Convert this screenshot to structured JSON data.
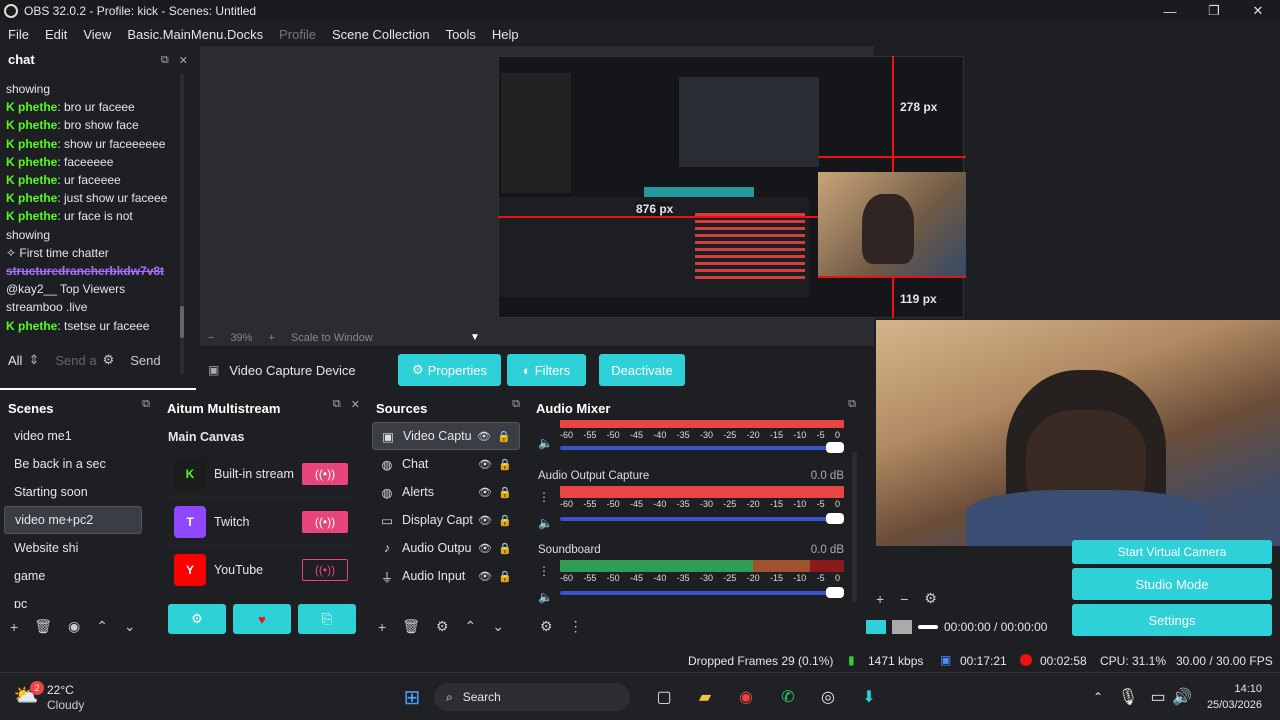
{
  "window": {
    "title": "OBS 32.0.2 - Profile: kick - Scenes: Untitled"
  },
  "menu": {
    "file": "File",
    "edit": "Edit",
    "view": "View",
    "docks": "Basic.MainMenu.Docks",
    "profile": "Profile",
    "scene_collection": "Scene Collection",
    "tools": "Tools",
    "help": "Help"
  },
  "chat": {
    "title": "chat",
    "lines": [
      {
        "user": "",
        "text": "showing"
      },
      {
        "user": "phethe",
        "text": ": bro ur faceee"
      },
      {
        "user": "phethe",
        "text": ": bro show face"
      },
      {
        "user": "phethe",
        "text": ": show ur faceeeeee"
      },
      {
        "user": "phethe",
        "text": ": faceeeee"
      },
      {
        "user": "phethe",
        "text": ": ur faceeee"
      },
      {
        "user": "phethe",
        "text": ": just show ur faceee"
      },
      {
        "user": "phethe",
        "text": ": ur face is not"
      },
      {
        "user": "",
        "text": "showing"
      }
    ],
    "first_time": "First time chatter",
    "purple_user": "structuredrancherbkdw7v8t",
    "viewers_line": "@kay2__ Top Viewers",
    "streamboo": "streamboo .live",
    "last_line": {
      "user": "phethe",
      "text": ": tsetse ur faceee"
    },
    "filter": "All",
    "send_placeholder": "Send a",
    "send_label": "Send"
  },
  "preview": {
    "zoom": "39%",
    "scale_mode": "Scale to Window",
    "measure_top": "278 px",
    "measure_left": "876 px",
    "measure_bottom": "119 px"
  },
  "source_bar": {
    "name": "Video Capture Device",
    "properties": "Properties",
    "filters": "Filters",
    "deactivate": "Deactivate"
  },
  "scenes": {
    "title": "Scenes",
    "items": [
      "video me1",
      "Be back in a sec",
      "Starting soon",
      "video me+pc2",
      "Website shi",
      "game",
      "pc"
    ],
    "selected_index": 3
  },
  "multistream": {
    "title": "Aitum Multistream",
    "canvas": "Main Canvas",
    "rows": [
      {
        "icon": "K",
        "label": "Built-in stream",
        "color": "#1c1c1c"
      },
      {
        "icon": "T",
        "label": "Twitch",
        "color": "#9146ff"
      },
      {
        "icon": "Y",
        "label": "YouTube",
        "color": "#ff0000"
      }
    ]
  },
  "sources": {
    "title": "Sources",
    "items": [
      {
        "icon": "camera-icon",
        "glyph": "▣",
        "label": "Video Captu"
      },
      {
        "icon": "globe-icon",
        "glyph": "◍",
        "label": "Chat"
      },
      {
        "icon": "globe-icon",
        "glyph": "◍",
        "label": "Alerts"
      },
      {
        "icon": "monitor-icon",
        "glyph": "▭",
        "label": "Display Capt"
      },
      {
        "icon": "speaker-icon",
        "glyph": "♪",
        "label": "Audio Outpu"
      },
      {
        "icon": "mic-icon",
        "glyph": "⏚",
        "label": "Audio Input"
      }
    ]
  },
  "mixer": {
    "title": "Audio Mixer",
    "ticks": [
      "-60",
      "-55",
      "-50",
      "-45",
      "-40",
      "-35",
      "-30",
      "-25",
      "-20",
      "-15",
      "-10",
      "-5",
      "0"
    ],
    "channels": [
      {
        "name": "Audio Output Capture",
        "db": "0.0 dB",
        "color": "#e94545"
      },
      {
        "name": "Soundboard",
        "db": "0.0 dB",
        "color": "#2e9e55"
      }
    ]
  },
  "controls": {
    "virtual_camera": "Start Virtual Camera",
    "studio_mode": "Studio Mode",
    "settings": "Settings",
    "time": "00:00:00 / 00:00:00"
  },
  "status": {
    "dropped": "Dropped Frames 29 (0.1%)",
    "bitrate": "1471 kbps",
    "stream_time": "00:17:21",
    "rec_time": "00:02:58",
    "cpu": "CPU: 31.1%",
    "fps": "30.00 / 30.00 FPS"
  },
  "taskbar": {
    "temp": "22°C",
    "weather": "Cloudy",
    "badge": "2",
    "search": "Search",
    "time": "14:10",
    "date": "25/03/2026"
  },
  "colors": {
    "accent": "#2ed1d8",
    "live_toggle": "#e8457a",
    "red": "#e11d1d"
  }
}
